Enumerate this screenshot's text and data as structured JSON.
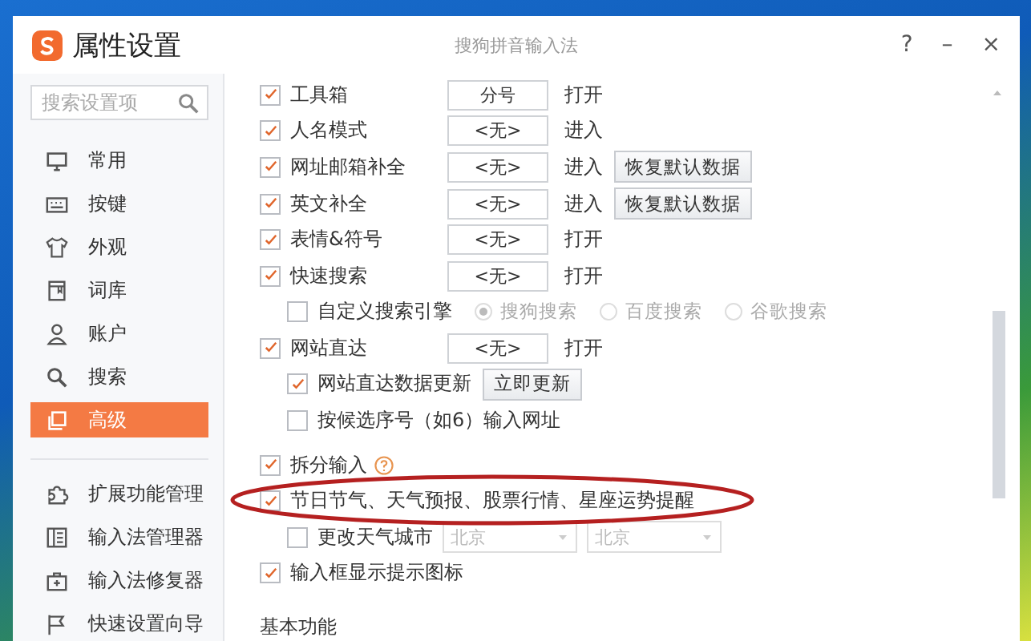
{
  "window": {
    "title": "属性设置",
    "app_name": "搜狗拼音输入法",
    "controls": [
      "?",
      "–",
      "×"
    ]
  },
  "sidebar": {
    "search": {
      "placeholder": "搜索设置项"
    },
    "items": [
      {
        "label": "常用",
        "selected": false
      },
      {
        "label": "按键",
        "selected": false
      },
      {
        "label": "外观",
        "selected": false
      },
      {
        "label": "词库",
        "selected": false
      },
      {
        "label": "账户",
        "selected": false
      },
      {
        "label": "搜索",
        "selected": false
      },
      {
        "label": "高级",
        "selected": true
      }
    ],
    "tools": [
      {
        "label": "扩展功能管理"
      },
      {
        "label": "输入法管理器"
      },
      {
        "label": "输入法修复器"
      },
      {
        "label": "快速设置向导"
      }
    ]
  },
  "rows": [
    {
      "kind": "hotkey",
      "label": "工具箱",
      "checked": true,
      "value": "分号",
      "action": "打开"
    },
    {
      "kind": "hotkey",
      "label": "人名模式",
      "checked": true,
      "value": "<无>",
      "action": "进入"
    },
    {
      "kind": "hotkey",
      "label": "网址邮箱补全",
      "checked": true,
      "value": "<无>",
      "action": "进入",
      "button": "恢复默认数据"
    },
    {
      "kind": "hotkey",
      "label": "英文补全",
      "checked": true,
      "value": "<无>",
      "action": "进入",
      "button": "恢复默认数据"
    },
    {
      "kind": "hotkey",
      "label": "表情&符号",
      "checked": true,
      "value": "<无>",
      "action": "打开"
    },
    {
      "kind": "hotkey",
      "label": "快速搜索",
      "checked": true,
      "value": "<无>",
      "action": "打开"
    },
    {
      "kind": "engines",
      "label": "自定义搜索引擎",
      "checked": false,
      "options": [
        {
          "label": "搜狗搜索",
          "selected": true
        },
        {
          "label": "百度搜索",
          "selected": false
        },
        {
          "label": "谷歌搜索",
          "selected": false
        }
      ]
    },
    {
      "kind": "hotkey",
      "label": "网站直达",
      "checked": true,
      "value": "<无>",
      "action": "打开"
    },
    {
      "kind": "sub",
      "label": "网站直达数据更新",
      "checked": true,
      "button": "立即更新"
    },
    {
      "kind": "sub",
      "label": "按候选序号（如6）输入网址",
      "checked": false
    },
    {
      "kind": "help",
      "label": "拆分输入",
      "checked": true
    },
    {
      "kind": "check",
      "label": "节日节气、天气预报、股票行情、星座运势提醒",
      "checked": true,
      "circled": true
    },
    {
      "kind": "city",
      "label": "更改天气城市",
      "checked": false,
      "province": "北京",
      "city": "北京"
    },
    {
      "kind": "check",
      "label": "输入框显示提示图标",
      "checked": true
    }
  ],
  "section_heading": "基本功能"
}
